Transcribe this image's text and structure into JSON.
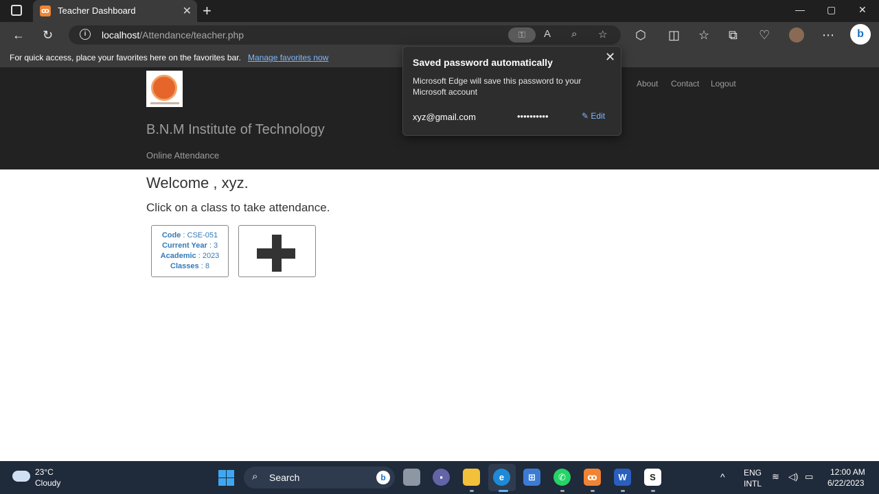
{
  "browser": {
    "tab_title": "Teacher Dashboard",
    "url_host": "localhost",
    "url_path": "/Attendance/teacher.php",
    "favbar_message": "For quick access, place your favorites here on the favorites bar.",
    "favbar_link": "Manage favorites now"
  },
  "site": {
    "brand": "B.N.M Institute of Technology",
    "subtitle": "Online Attendance",
    "nav": [
      "About",
      "Contact",
      "Logout"
    ]
  },
  "popup": {
    "title": "Saved password automatically",
    "description": "Microsoft Edge will save this password to your Microsoft account",
    "email": "xyz@gmail.com",
    "password_mask": "••••••••••",
    "edit_label": "Edit"
  },
  "content": {
    "welcome": "Welcome , xyz.",
    "instruction": "Click on a class to take attendance.",
    "class_card": {
      "code_label": "Code",
      "code_value": "CSE-051",
      "year_label": "Current Year",
      "year_value": "3",
      "academic_label": "Academic",
      "academic_value": "2023",
      "classes_label": "Classes",
      "classes_value": "8"
    }
  },
  "taskbar": {
    "temperature": "23°C",
    "condition": "Cloudy",
    "search_label": "Search",
    "lang_top": "ENG",
    "lang_bottom": "INTL",
    "time": "12:00 AM",
    "date": "6/22/2023"
  },
  "colors": {
    "header_bg": "#222222",
    "link_blue": "#337ab7",
    "taskbar_bg": "#1f2a3a"
  }
}
